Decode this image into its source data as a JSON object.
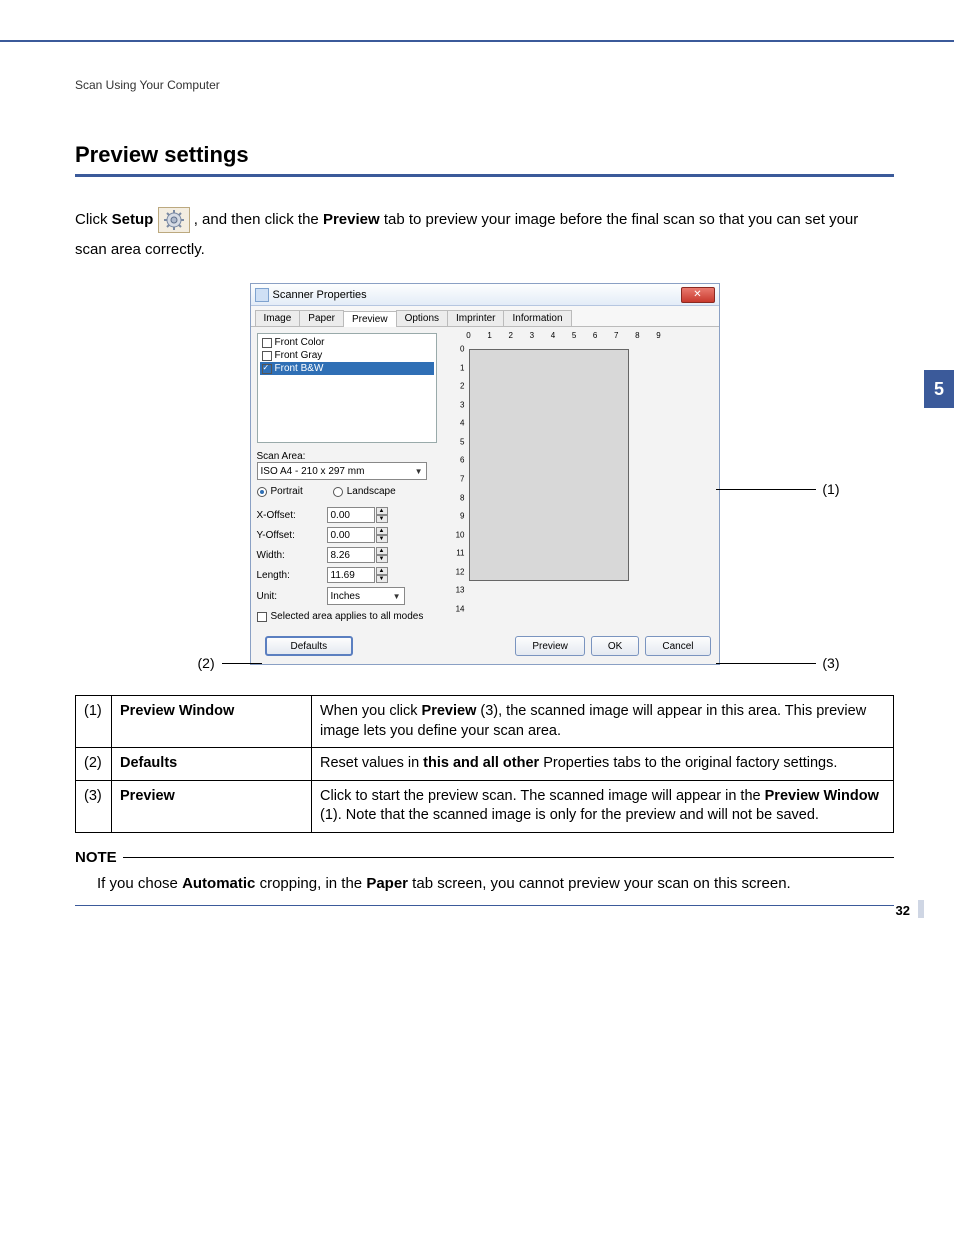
{
  "breadcrumb": "Scan Using Your Computer",
  "chapter_number": "5",
  "page_number": "32",
  "section_title": "Preview settings",
  "intro": {
    "pre1": "Click ",
    "setup_bold": "Setup",
    "mid1": " , and then click the ",
    "preview_bold": "Preview",
    "post1": " tab to preview your image before the final scan so that you can set your scan area correctly."
  },
  "dialog": {
    "title": "Scanner Properties",
    "tabs": [
      "Image",
      "Paper",
      "Preview",
      "Options",
      "Imprinter",
      "Information"
    ],
    "active_tab_index": 2,
    "list_items": [
      {
        "label": "Front Color",
        "checked": false
      },
      {
        "label": "Front Gray",
        "checked": false
      },
      {
        "label": "Front B&W",
        "checked": true,
        "selected": true
      }
    ],
    "scan_area_label": "Scan Area:",
    "scan_area_value": "ISO A4 - 210 x 297 mm",
    "orientation": {
      "portrait_label": "Portrait",
      "landscape_label": "Landscape",
      "selected": "portrait"
    },
    "fields": {
      "x_offset": {
        "label": "X-Offset:",
        "value": "0.00"
      },
      "y_offset": {
        "label": "Y-Offset:",
        "value": "0.00"
      },
      "width": {
        "label": "Width:",
        "value": "8.26"
      },
      "length": {
        "label": "Length:",
        "value": "11.69"
      },
      "unit": {
        "label": "Unit:",
        "value": "Inches"
      }
    },
    "all_modes_label": "Selected area applies to all modes",
    "ruler_top_max": 9,
    "ruler_left_max": 14,
    "buttons": {
      "defaults": "Defaults",
      "preview": "Preview",
      "ok": "OK",
      "cancel": "Cancel"
    }
  },
  "callouts": {
    "c1": "(1)",
    "c2": "(2)",
    "c3": "(3)"
  },
  "table": {
    "rows": [
      {
        "num": "(1)",
        "name": "Preview Window",
        "desc_pre": "When you click ",
        "desc_bold1": "Preview",
        "desc_mid": " (3), the scanned image will appear in this area. This preview image lets you define your scan area.",
        "desc_bold2": "",
        "desc_post": ""
      },
      {
        "num": "(2)",
        "name": "Defaults",
        "desc_pre": "Reset values in ",
        "desc_bold1": "this and all other",
        "desc_mid": " Properties tabs to the original factory settings.",
        "desc_bold2": "",
        "desc_post": ""
      },
      {
        "num": "(3)",
        "name": "Preview",
        "desc_pre": "Click to start the preview scan. The scanned image will appear in the ",
        "desc_bold1": "Preview Window",
        "desc_mid": " (1). Note that the scanned image is only for the preview and will not be saved.",
        "desc_bold2": "",
        "desc_post": ""
      }
    ]
  },
  "note": {
    "label": "NOTE",
    "body_pre": "If you chose ",
    "body_bold1": "Automatic",
    "body_mid": " cropping, in the ",
    "body_bold2": "Paper",
    "body_post": " tab screen, you cannot preview your scan on this screen."
  }
}
